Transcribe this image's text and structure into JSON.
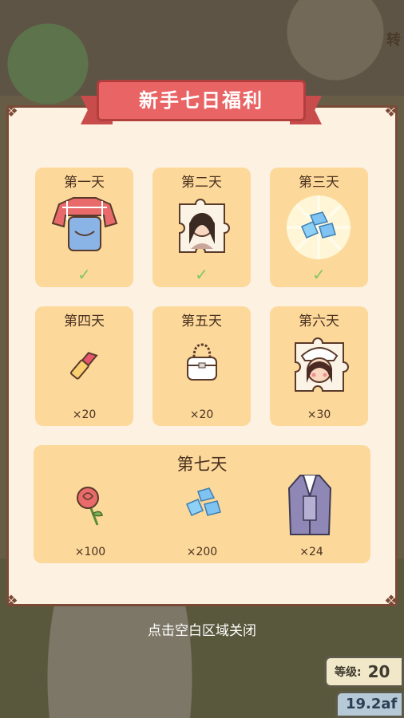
{
  "background": {
    "corner_text": "转",
    "level_label": "等级:",
    "level_value": "20",
    "currency_value": "19.2af"
  },
  "dialog": {
    "title": "新手七日福利",
    "close_hint": "点击空白区域关闭",
    "days": [
      {
        "label": "第一天",
        "reward_icon": "shirt-overalls-icon",
        "quantity": "",
        "claimed": true
      },
      {
        "label": "第二天",
        "reward_icon": "character-puzzle-icon",
        "quantity": "",
        "claimed": true
      },
      {
        "label": "第三天",
        "reward_icon": "diamond-gems-icon",
        "quantity": "",
        "claimed": true
      },
      {
        "label": "第四天",
        "reward_icon": "lipstick-icon",
        "quantity": "×20",
        "claimed": false
      },
      {
        "label": "第五天",
        "reward_icon": "handbag-icon",
        "quantity": "×20",
        "claimed": false
      },
      {
        "label": "第六天",
        "reward_icon": "character-puzzle-icon",
        "quantity": "×30",
        "claimed": false
      }
    ],
    "day7": {
      "label": "第七天",
      "rewards": [
        {
          "icon": "rose-icon",
          "quantity": "×100"
        },
        {
          "icon": "diamond-gems-icon",
          "quantity": "×200"
        },
        {
          "icon": "suit-coat-icon",
          "quantity": "×24"
        }
      ]
    },
    "check_mark": "✓"
  },
  "colors": {
    "ribbon": "#e96565",
    "card": "#fcd99a",
    "panel": "#fdf1e2",
    "check": "#7fc56a"
  }
}
